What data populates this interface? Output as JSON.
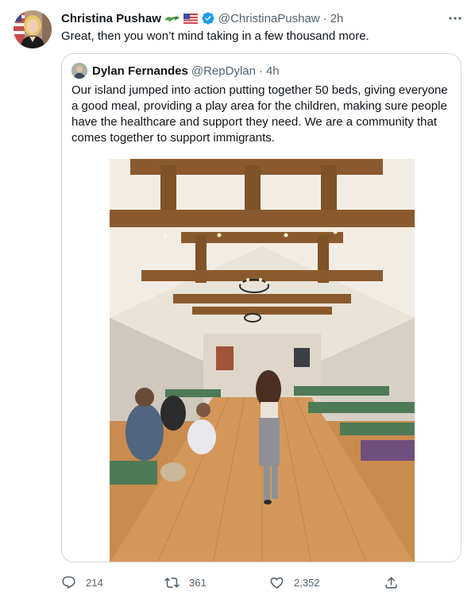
{
  "tweet": {
    "author_name": "Christina Pushaw",
    "author_emoji": [
      "alligator-emoji",
      "us-flag-emoji"
    ],
    "verified": true,
    "handle": "@ChristinaPushaw",
    "separator": "·",
    "time": "2h",
    "text": "Great, then you won’t mind taking in a few thousand more.",
    "quote": {
      "author_name": "Dylan Fernandes",
      "handle": "@RepDylan",
      "separator": "·",
      "time": "4h",
      "text": "Our island jumped into action putting together 50 beds, giving everyone a good meal, providing a play area for the children, making sure people have the healthcare and support they need. We are a community that comes together to support immigrants.",
      "media": "photo of a church hall with wooden beams, chandeliers and rows of green cots"
    },
    "actions": {
      "replies": "214",
      "retweets": "361",
      "likes": "2,352"
    }
  },
  "colors": {
    "text": "#0f1419",
    "secondary": "#536471",
    "border": "#cfd9de",
    "verified": "#1d9bf0"
  }
}
